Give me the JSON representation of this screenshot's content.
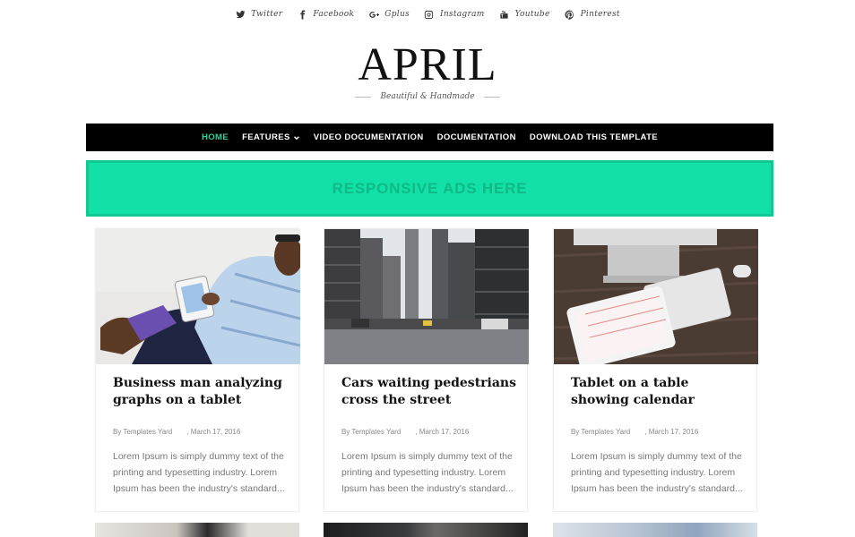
{
  "social": [
    {
      "label": "Twitter",
      "icon": "twitter-icon"
    },
    {
      "label": "Facebook",
      "icon": "facebook-icon"
    },
    {
      "label": "Gplus",
      "icon": "gplus-icon"
    },
    {
      "label": "Instagram",
      "icon": "instagram-icon"
    },
    {
      "label": "Youtube",
      "icon": "youtube-icon"
    },
    {
      "label": "Pinterest",
      "icon": "pinterest-icon"
    }
  ],
  "brand": {
    "title": "APRIL",
    "tagline": "Beautiful & Handmade"
  },
  "nav": [
    {
      "label": "HOME",
      "active": true
    },
    {
      "label": "FEATURES",
      "dropdown": true
    },
    {
      "label": "VIDEO DOCUMENTATION"
    },
    {
      "label": "DOCUMENTATION"
    },
    {
      "label": "DOWNLOAD THIS TEMPLATE"
    }
  ],
  "ads": {
    "label": "RESPONSIVE ADS HERE"
  },
  "posts": [
    {
      "title": "Business man analyzing graphs on a tablet",
      "author": "By Templates Yard",
      "date": ", March 17, 2016",
      "excerpt": "Lorem Ipsum is simply dummy text of the printing and typesetting industry. Lorem Ipsum has been the industry's standard..."
    },
    {
      "title": "Cars waiting pedestrians cross the street",
      "author": "By Templates Yard",
      "date": ", March 17, 2016",
      "excerpt": "Lorem Ipsum is simply dummy text of the printing and typesetting industry. Lorem Ipsum has been the industry's standard..."
    },
    {
      "title": "Tablet on a table showing calendar",
      "author": "By Templates Yard",
      "date": ", March 17, 2016",
      "excerpt": "Lorem Ipsum is simply dummy text of the printing and typesetting industry. Lorem Ipsum has been the industry's standard..."
    }
  ],
  "colors": {
    "accent": "#2ed39a",
    "ads_bg": "#12e0a6",
    "nav_bg": "#000000"
  }
}
